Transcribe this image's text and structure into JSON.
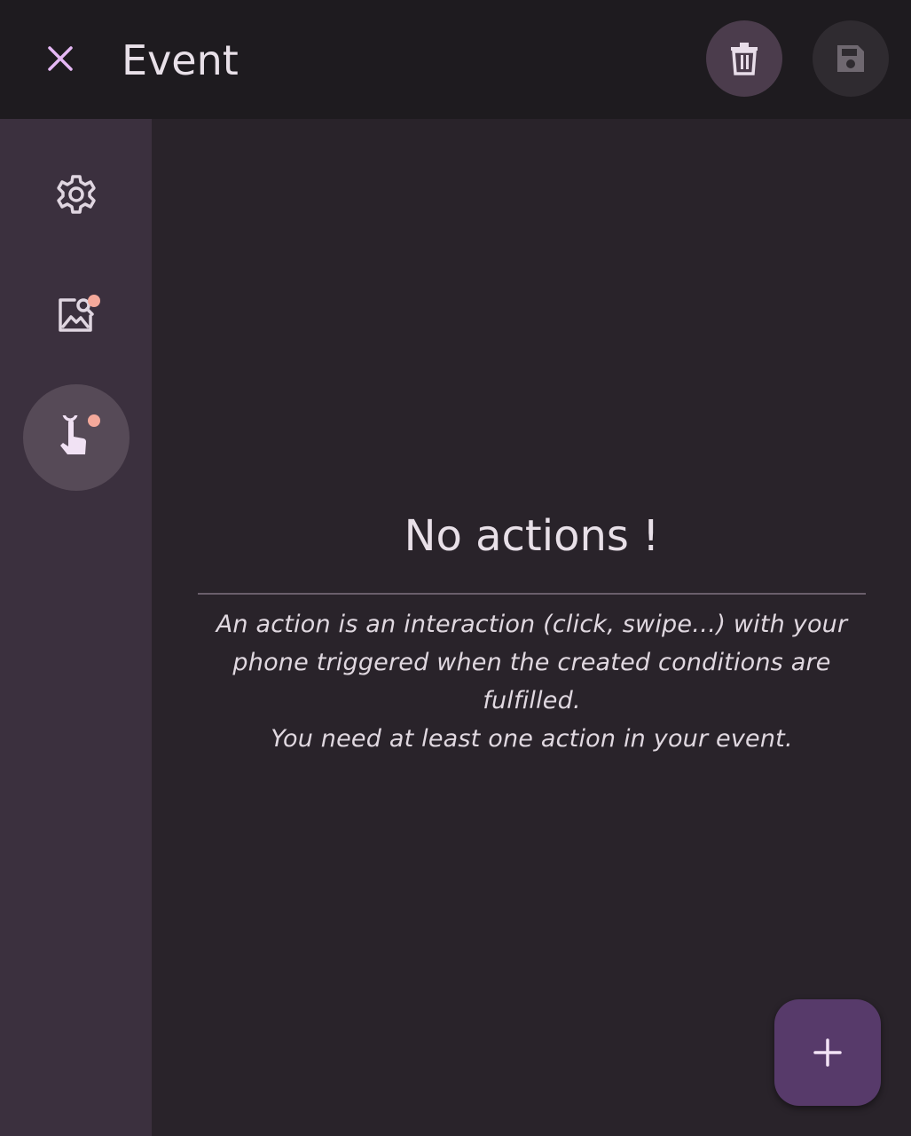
{
  "header": {
    "title": "Event",
    "close_icon": "close-icon",
    "delete_icon": "trash-icon",
    "save_icon": "save-icon"
  },
  "rail": {
    "items": [
      {
        "icon": "gear-icon",
        "active": false,
        "badge": false
      },
      {
        "icon": "image-search-icon",
        "active": false,
        "badge": true
      },
      {
        "icon": "touch-icon",
        "active": true,
        "badge": true
      }
    ]
  },
  "empty_state": {
    "title": "No actions !",
    "line1": "An action is an interaction (click, swipe…) with your",
    "line2": "phone triggered when the created conditions are",
    "line3": "fulfilled.",
    "line4": "You need at least one action in your event."
  },
  "fab": {
    "icon": "plus-icon"
  },
  "colors": {
    "accent": "#e5b8f4",
    "fab_background": "#573a6a",
    "badge": "#f4a99b",
    "rail_background": "#3b303e",
    "topbar_background": "#1e1b1f"
  }
}
